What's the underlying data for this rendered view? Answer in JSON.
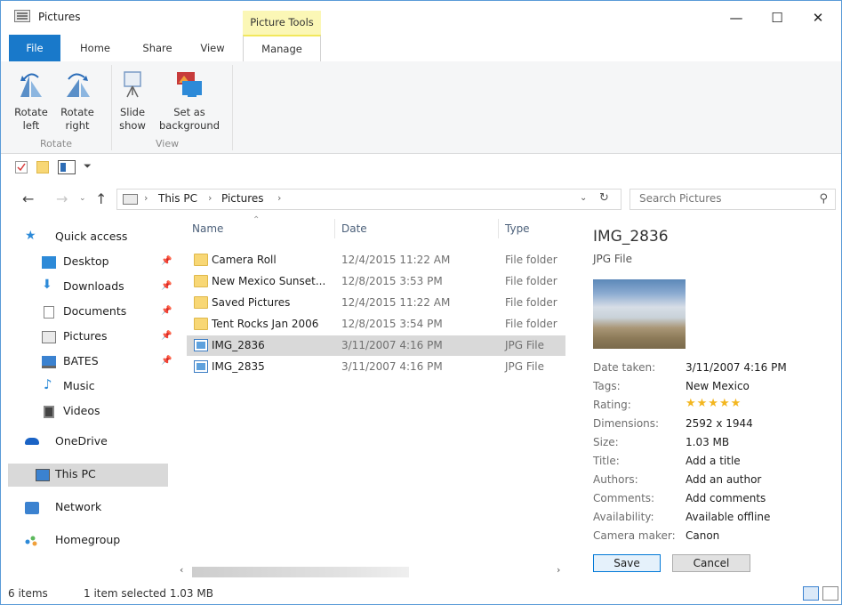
{
  "window": {
    "title": "Pictures",
    "contextual_group": "Picture Tools",
    "controls": {
      "minimize": "—",
      "maximize": "☐",
      "close": "✕"
    }
  },
  "tabs": [
    {
      "label": "File"
    },
    {
      "label": "Home"
    },
    {
      "label": "Share"
    },
    {
      "label": "View"
    },
    {
      "label": "Manage"
    }
  ],
  "ribbon": {
    "rotate_left": {
      "line1": "Rotate",
      "line2": "left"
    },
    "rotate_right": {
      "line1": "Rotate",
      "line2": "right"
    },
    "slide_show": {
      "line1": "Slide",
      "line2": "show"
    },
    "set_background": {
      "line1": "Set as",
      "line2": "background"
    },
    "group_rotate": "Rotate",
    "group_view": "View"
  },
  "navigation": {
    "back": "←",
    "forward": "→",
    "up": "↑",
    "breadcrumbs": [
      "This PC",
      "Pictures"
    ],
    "separator": "›",
    "search_placeholder": "Search Pictures"
  },
  "sidebar": {
    "items": [
      {
        "label": "Quick access",
        "icon": "star-icon"
      },
      {
        "label": "Desktop",
        "icon": "desktop-icon",
        "pinned": true
      },
      {
        "label": "Downloads",
        "icon": "downloads-icon",
        "pinned": true
      },
      {
        "label": "Documents",
        "icon": "documents-icon",
        "pinned": true
      },
      {
        "label": "Pictures",
        "icon": "pictures-icon",
        "pinned": true
      },
      {
        "label": "BATES",
        "icon": "drive-icon",
        "pinned": true
      },
      {
        "label": "Music",
        "icon": "music-icon"
      },
      {
        "label": "Videos",
        "icon": "videos-icon"
      },
      {
        "label": "OneDrive",
        "icon": "cloud-icon"
      },
      {
        "label": "This PC",
        "icon": "computer-icon",
        "selected": true
      },
      {
        "label": "Network",
        "icon": "network-icon"
      },
      {
        "label": "Homegroup",
        "icon": "homegroup-icon"
      }
    ]
  },
  "file_list": {
    "columns": {
      "name": "Name",
      "date": "Date",
      "type": "Type"
    },
    "rows": [
      {
        "name": "Camera Roll",
        "date": "12/4/2015 11:22 AM",
        "type": "File folder",
        "kind": "folder"
      },
      {
        "name": "New Mexico Sunset...",
        "date": "12/8/2015 3:53 PM",
        "type": "File folder",
        "kind": "folder"
      },
      {
        "name": "Saved Pictures",
        "date": "12/4/2015 11:22 AM",
        "type": "File folder",
        "kind": "folder"
      },
      {
        "name": "Tent Rocks Jan 2006",
        "date": "12/8/2015 3:54 PM",
        "type": "File folder",
        "kind": "folder"
      },
      {
        "name": "IMG_2836",
        "date": "3/11/2007 4:16 PM",
        "type": "JPG File",
        "kind": "jpg",
        "selected": true
      },
      {
        "name": "IMG_2835",
        "date": "3/11/2007 4:16 PM",
        "type": "JPG File",
        "kind": "jpg"
      }
    ]
  },
  "preview": {
    "title": "IMG_2836",
    "type": "JPG File",
    "properties": [
      {
        "key": "Date taken:",
        "value": "3/11/2007 4:16 PM"
      },
      {
        "key": "Tags:",
        "value": "New Mexico"
      },
      {
        "key": "Rating:",
        "value": "★★★★★",
        "rating": 5
      },
      {
        "key": "Dimensions:",
        "value": "2592 x 1944"
      },
      {
        "key": "Size:",
        "value": "1.03 MB"
      },
      {
        "key": "Title:",
        "value": "Add a title"
      },
      {
        "key": "Authors:",
        "value": "Add an author"
      },
      {
        "key": "Comments:",
        "value": "Add comments"
      },
      {
        "key": "Availability:",
        "value": "Available offline"
      },
      {
        "key": "Camera maker:",
        "value": "Canon"
      }
    ],
    "save_label": "Save",
    "cancel_label": "Cancel"
  },
  "status": {
    "items_count": "6 items",
    "selection": "1 item selected 1.03 MB"
  },
  "colors": {
    "accent": "#1979ca",
    "contextual": "#fbf7b6",
    "selection": "#d9d9d9",
    "star": "#f3b61f"
  }
}
